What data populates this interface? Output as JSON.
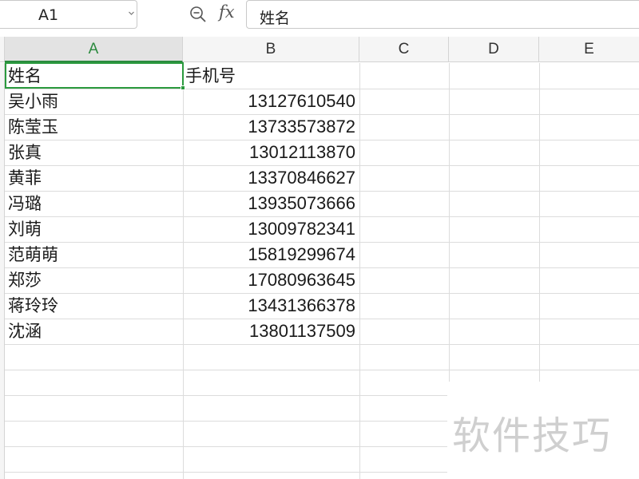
{
  "formula_bar": {
    "name_box_value": "A1",
    "fx_label": "fx",
    "formula_value": "姓名",
    "icons": {
      "name_box_dropdown": "chevron-down-icon",
      "zoom": "zoom-out-icon"
    }
  },
  "columns": [
    {
      "label": "A",
      "selected": true
    },
    {
      "label": "B",
      "selected": false
    },
    {
      "label": "C",
      "selected": false
    },
    {
      "label": "D",
      "selected": false
    },
    {
      "label": "E",
      "selected": false
    }
  ],
  "header_row": {
    "a": "姓名",
    "b": "手机号"
  },
  "rows": [
    {
      "name": "吴小雨",
      "phone": "13127610540"
    },
    {
      "name": "陈莹玉",
      "phone": "13733573872"
    },
    {
      "name": "张真",
      "phone": "13012113870"
    },
    {
      "name": "黄菲",
      "phone": "13370846627"
    },
    {
      "name": "冯璐",
      "phone": "13935073666"
    },
    {
      "name": "刘萌",
      "phone": "13009782341"
    },
    {
      "name": "范萌萌",
      "phone": "15819299674"
    },
    {
      "name": "郑莎",
      "phone": "17080963645"
    },
    {
      "name": "蒋玲玲",
      "phone": "13431366378"
    },
    {
      "name": "沈涵",
      "phone": "13801137509"
    }
  ],
  "colors": {
    "selection": "#2b9a3e",
    "grid": "#dcdcdc",
    "header_bg": "#f5f5f5"
  },
  "watermark": "软件技巧"
}
